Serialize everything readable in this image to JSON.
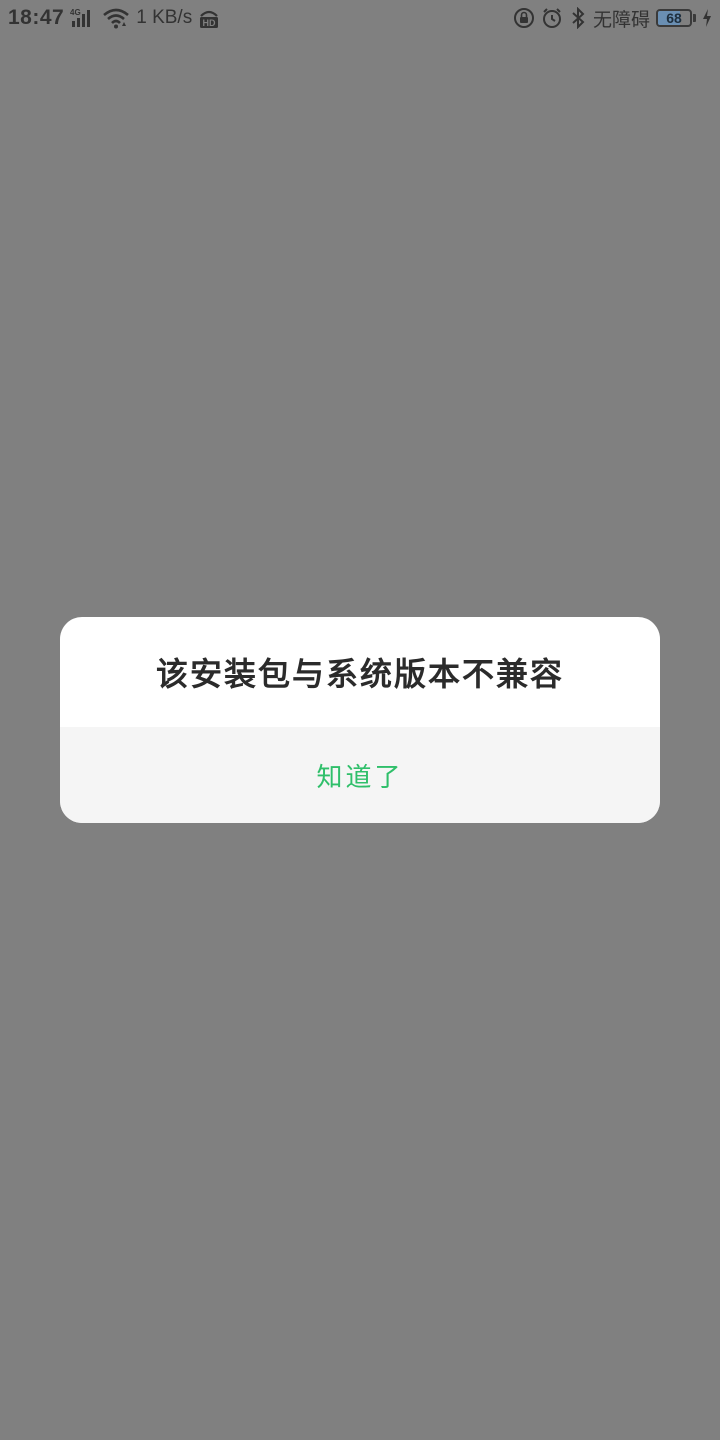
{
  "status_bar": {
    "time": "18:47",
    "network_type": "4G",
    "speed": "1 KB/s",
    "hd_label": "HD",
    "accessibility_label": "无障碍",
    "battery_level": "68",
    "battery_fraction": 0.68,
    "icons": [
      "signal-icon",
      "wifi-icon",
      "hd-icon",
      "lock-rotation-icon",
      "alarm-icon",
      "bluetooth-icon",
      "battery-icon",
      "charging-icon"
    ]
  },
  "colors": {
    "overlay": "#808080",
    "dialog_bg": "#ffffff",
    "footer_bg": "#f5f5f5",
    "accent_green": "#2fbf6a",
    "battery_fill": "#6a8fb3"
  },
  "dialog": {
    "message": "该安装包与系统版本不兼容",
    "ok_label": "知道了"
  }
}
